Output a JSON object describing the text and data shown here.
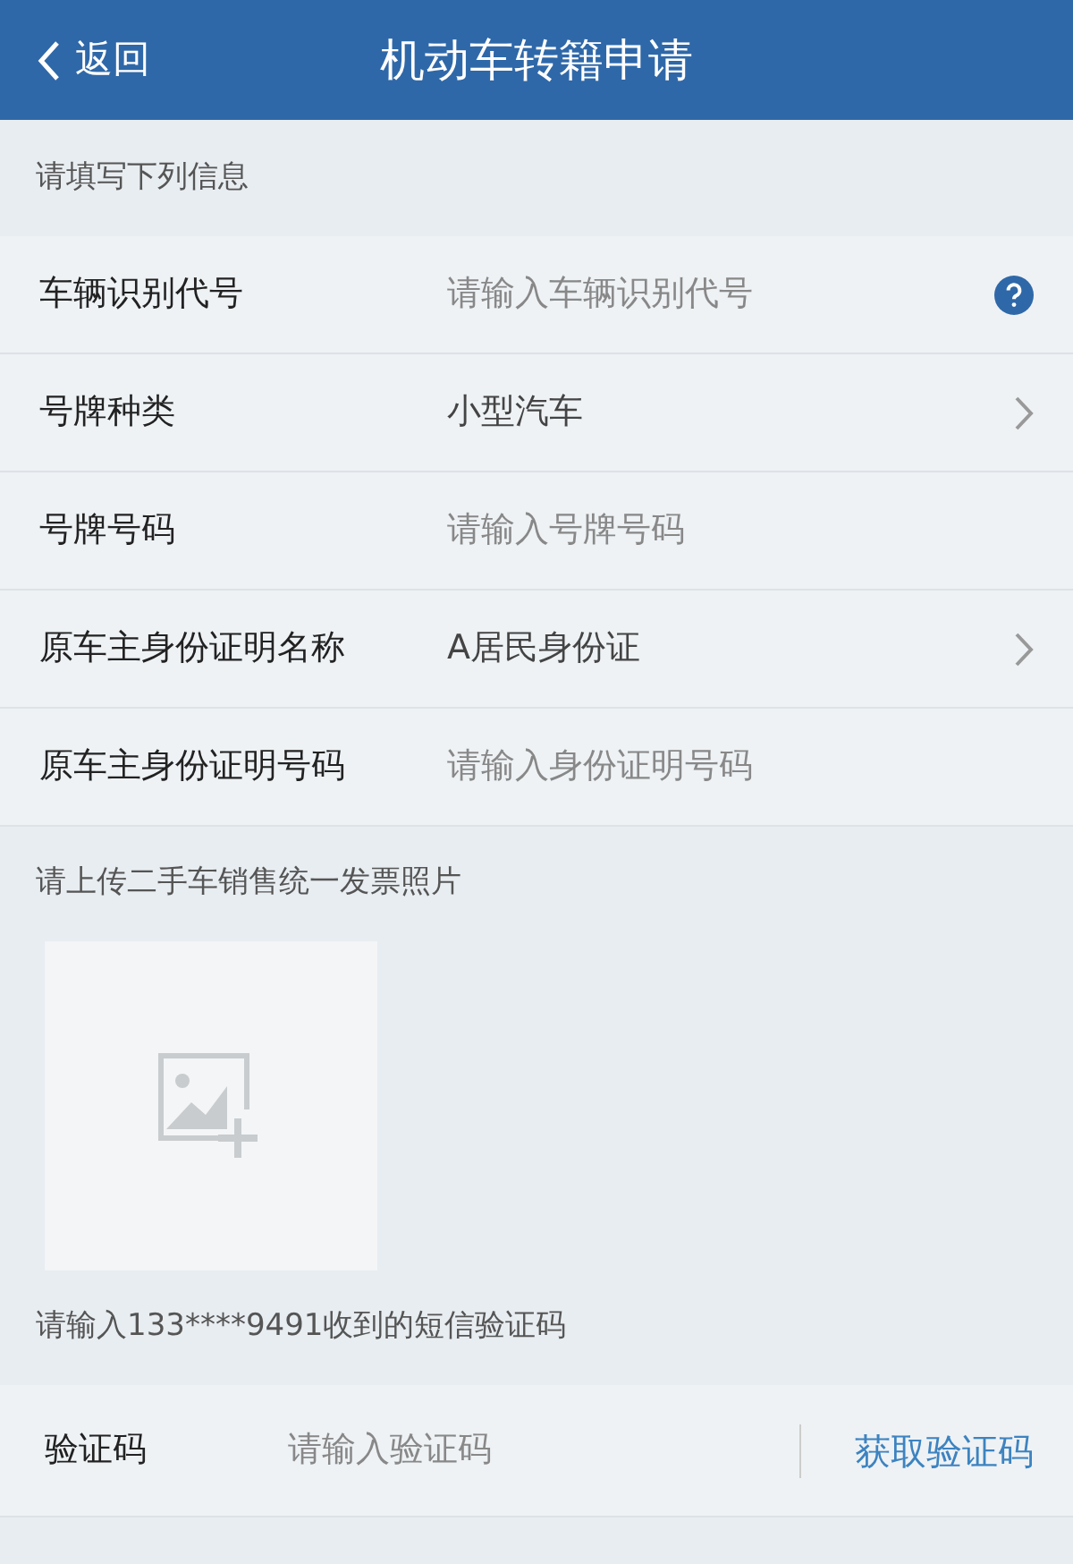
{
  "header": {
    "back": "返回",
    "title": "机动车转籍申请"
  },
  "form_section": {
    "label": "请填写下列信息",
    "rows": [
      {
        "kind": "input",
        "label": "车辆识别代号",
        "placeholder": "请输入车辆识别代号",
        "help": true
      },
      {
        "kind": "select",
        "label": "号牌种类",
        "value": "小型汽车"
      },
      {
        "kind": "input",
        "label": "号牌号码",
        "placeholder": "请输入号牌号码"
      },
      {
        "kind": "select",
        "label": "原车主身份证明名称",
        "value": "A居民身份证"
      },
      {
        "kind": "input",
        "label": "原车主身份证明号码",
        "placeholder": "请输入身份证明号码"
      }
    ]
  },
  "upload_section": {
    "label": "请上传二手车销售统一发票照片"
  },
  "sms_section": {
    "label": "请输入133****9491收到的短信验证码",
    "field_label": "验证码",
    "placeholder": "请输入验证码",
    "button": "获取验证码"
  }
}
